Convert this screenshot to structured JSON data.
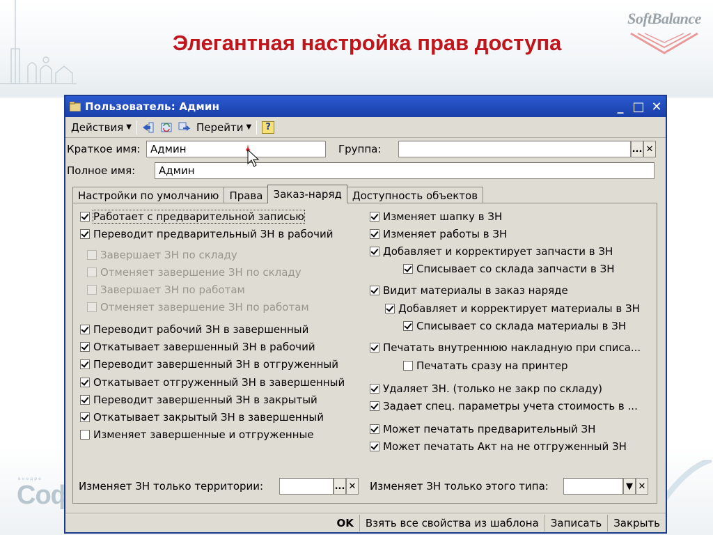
{
  "slide": {
    "title": "Элегантная настройка прав доступа",
    "logo_text": "SoftBalance",
    "bottom_logo_text": "Соф",
    "bottom_logo_small": "внедре"
  },
  "window": {
    "title": "Пользователь: Админ",
    "controls": {
      "minimize": "_",
      "maximize": "□",
      "close": "✕"
    }
  },
  "toolbar": {
    "actions_label": "Действия",
    "goto_label": "Перейти",
    "help_label": "?"
  },
  "fields": {
    "short_name_label": "Краткое имя:",
    "short_name_value": "Админ",
    "group_label": "Группа:",
    "group_value": "",
    "full_name_label": "Полное имя:",
    "full_name_value": "Админ",
    "select_btn": "...",
    "clear_btn": "✕"
  },
  "tabs": [
    {
      "label": "Настройки по умолчанию",
      "active": false
    },
    {
      "label": "Права",
      "active": false
    },
    {
      "label": "Заказ-наряд",
      "active": true
    },
    {
      "label": "Доступность объектов",
      "active": false
    }
  ],
  "left_column": [
    {
      "label": "Работает с предварительной записью",
      "checked": true,
      "disabled": false
    },
    {
      "label": "Переводит предварительный ЗН в рабочий",
      "checked": true,
      "disabled": false
    },
    {
      "label": "Завершает ЗН по складу",
      "checked": false,
      "disabled": true
    },
    {
      "label": "Отменяет завершение ЗН по складу",
      "checked": false,
      "disabled": true
    },
    {
      "label": "Завершает ЗН по работам",
      "checked": false,
      "disabled": true
    },
    {
      "label": "Отменяет завершение ЗН по работам",
      "checked": false,
      "disabled": true
    },
    {
      "label": "Переводит рабочий ЗН в завершенный",
      "checked": true,
      "disabled": false
    },
    {
      "label": "Откатывает завершенный ЗН в рабочий",
      "checked": true,
      "disabled": false
    },
    {
      "label": "Переводит завершенный ЗН в отгруженный",
      "checked": true,
      "disabled": false
    },
    {
      "label": "Откатывает отгруженный ЗН в завершенный",
      "checked": true,
      "disabled": false
    },
    {
      "label": "Переводит завершенный ЗН в закрытый",
      "checked": true,
      "disabled": false
    },
    {
      "label": "Откатывает закрытый ЗН в завершенный",
      "checked": true,
      "disabled": false
    },
    {
      "label": "Изменяет завершенные и отгруженные",
      "checked": false,
      "disabled": false
    }
  ],
  "right_column": [
    {
      "label": "Изменяет шапку в ЗН",
      "checked": true
    },
    {
      "label": "Изменяет работы в ЗН",
      "checked": true
    },
    {
      "label": "Добавляет и корректирует запчасти в ЗН",
      "checked": true
    },
    {
      "label": "Списывает со склада запчасти в ЗН",
      "checked": true
    },
    {
      "label": "Видит материалы в заказ наряде",
      "checked": true
    },
    {
      "label": "Добавляет и корректирует материалы в ЗН",
      "checked": true
    },
    {
      "label": "Списывает со склада материалы в ЗН",
      "checked": true
    },
    {
      "label": "Печатать внутреннюю накладную при списа...",
      "checked": true
    },
    {
      "label": "Печатать сразу на принтер",
      "checked": false
    },
    {
      "label": "Удаляет ЗН. (только не закр по складу)",
      "checked": true
    },
    {
      "label": "Задает спец. параметры учета стоимость в ...",
      "checked": true
    },
    {
      "label": "Может печатать предварительный ЗН",
      "checked": true
    },
    {
      "label": "Может печатать Акт на не отгруженный ЗН",
      "checked": true
    }
  ],
  "bottom_fields": {
    "territory_label": "Изменяет ЗН только территории:",
    "territory_value": "",
    "type_label": "Изменяет ЗН только этого типа:",
    "type_value": "",
    "dropdown_btn": "▼"
  },
  "status_bar": {
    "ok": "OK",
    "template": "Взять все свойства из шаблона",
    "save": "Записать",
    "close": "Закрыть"
  }
}
